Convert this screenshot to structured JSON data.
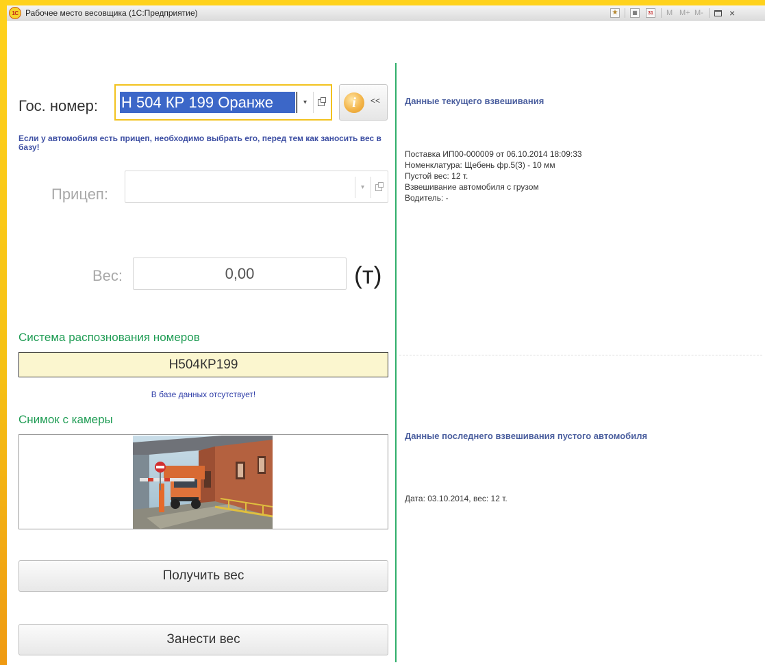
{
  "window": {
    "title": "Рабочее место весовщика  (1С:Предприятие)",
    "logo_text": "1С",
    "toolbar": {
      "memory_labels": [
        "M",
        "M+",
        "M-"
      ],
      "calendar_day": "31"
    }
  },
  "plate": {
    "label": "Гос. номер:",
    "value": "Н 504 КР 199 Оранже",
    "collapse_label": "<<"
  },
  "hint": "Если у автомобиля есть прицеп, необходимо выбрать его, перед тем как заносить вес в базу!",
  "trailer": {
    "label": "Прицеп:",
    "value": ""
  },
  "weight": {
    "label": "Вес:",
    "value": "0,00",
    "unit": "(т)"
  },
  "recognition": {
    "title": "Система распознования номеров",
    "plate": "Н504КР199",
    "status": "В базе данных отсутствует!"
  },
  "camera": {
    "title": "Снимок с камеры"
  },
  "buttons": {
    "get_weight": "Получить вес",
    "save_weight": "Занести вес"
  },
  "current": {
    "title": "Данные текущего взвешивания",
    "lines": [
      "Поставка ИП00-000009 от 06.10.2014 18:09:33",
      "Номенклатура: Щебень фр.5(3) - 10 мм",
      "Пустой вес: 12 т.",
      "Взвешивание автомобиля с грузом",
      "Водитель: -"
    ]
  },
  "last_empty": {
    "title": "Данные последнего взвешивания пустого автомобиля",
    "text": "Дата: 03.10.2014, вес: 12 т."
  },
  "colors": {
    "accent_blue": "#3c67c8",
    "focus_border": "#f2c21e",
    "section_green": "#1f9c54",
    "divider_green": "#2fae6a",
    "recognition_bg": "#fbf6cf"
  }
}
